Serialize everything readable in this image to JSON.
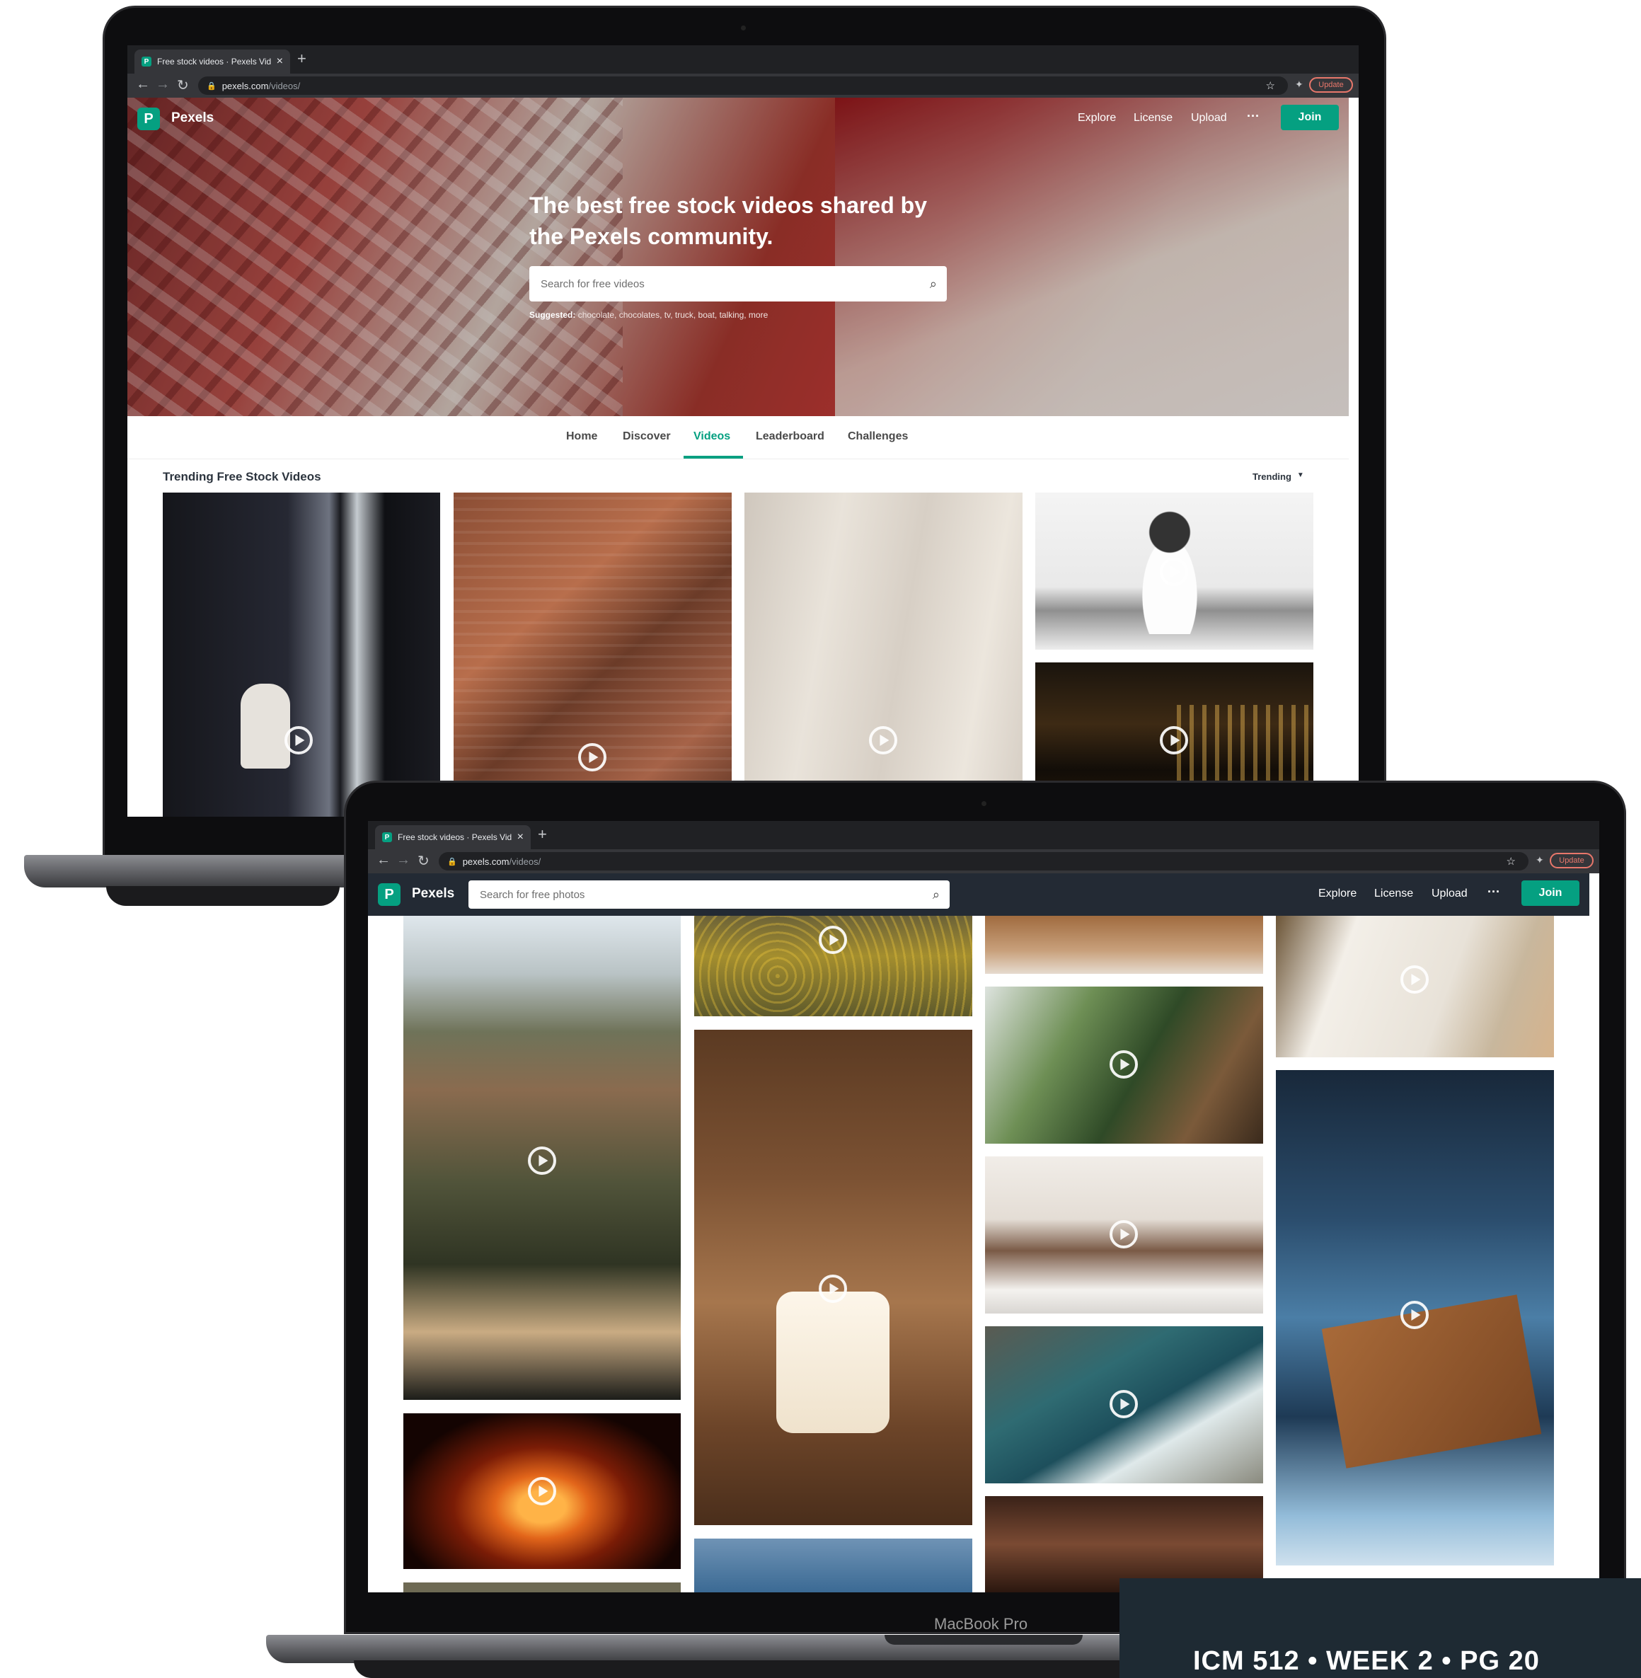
{
  "laptop_top": {
    "browser": {
      "tab_title": "Free stock videos · Pexels Vide",
      "tab_close": "×",
      "new_tab": "+",
      "url_host": "pexels.com",
      "url_path": "/videos/",
      "update_label": "Update"
    },
    "site": {
      "logo_letter": "P",
      "brand": "Pexels",
      "nav": [
        "Explore",
        "License",
        "Upload",
        "···"
      ],
      "join": "Join",
      "hero_title": "The best free stock videos shared by the Pexels community.",
      "search_placeholder": "Search for free videos",
      "suggested_label": "Suggested:",
      "suggested_items": "chocolate, chocolates, tv, truck, boat, talking, more",
      "tabs": [
        "Home",
        "Discover",
        "Videos",
        "Leaderboard",
        "Challenges"
      ],
      "active_tab": "Videos",
      "section_title": "Trending Free Stock Videos",
      "sort_label": "Trending"
    }
  },
  "laptop_bottom": {
    "browser": {
      "tab_title": "Free stock videos · Pexels Vide",
      "tab_close": "×",
      "new_tab": "+",
      "url_host": "pexels.com",
      "url_path": "/videos/",
      "update_label": "Update"
    },
    "site": {
      "logo_letter": "P",
      "brand": "Pexels",
      "search_placeholder": "Search for free photos",
      "nav": [
        "Explore",
        "License",
        "Upload",
        "···"
      ],
      "join": "Join"
    },
    "model_label": "MacBook Pro"
  },
  "footer_tile": {
    "text": "ICM 512 • WEEK 2 • PG 20"
  },
  "colors": {
    "accent": "#05a081",
    "tile": "#1e2a33",
    "chrome_dark": "#202124",
    "chrome_bar": "#35363a"
  },
  "icons": [
    "back-icon",
    "forward-icon",
    "reload-icon",
    "lock-icon",
    "star-icon",
    "extensions-icon",
    "search-icon",
    "play-icon",
    "chevron-down-icon",
    "close-icon",
    "plus-icon"
  ]
}
